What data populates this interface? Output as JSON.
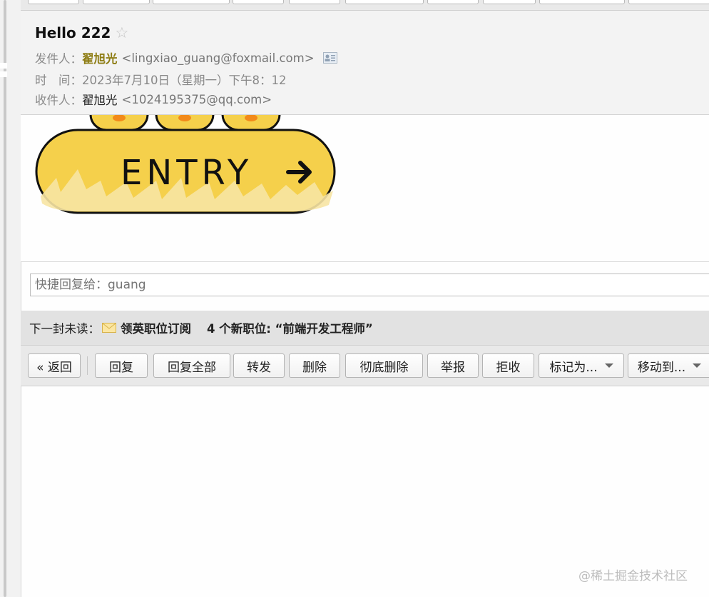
{
  "header": {
    "subject": "Hello 222",
    "sender_label": "发件人：",
    "sender_name": "翟旭光",
    "sender_email": "<lingxiao_guang@foxmail.com>",
    "time_label": "时　间：",
    "time_value": "2023年7月10日（星期一）下午8：12",
    "recipient_label": "收件人：",
    "recipient_name": "翟旭光",
    "recipient_email": "<1024195375@qq.com>"
  },
  "body": {
    "entry_text": "ENTRY"
  },
  "quick_reply": {
    "placeholder": "快捷回复给：guang"
  },
  "next_unread": {
    "label": "下一封未读：",
    "sender": "领英职位订阅",
    "subject": "4 个新职位: “前端开发工程师”"
  },
  "toolbar": {
    "back": "« 返回",
    "reply": "回复",
    "reply_all": "回复全部",
    "forward": "转发",
    "delete": "删除",
    "delete_permanently": "彻底删除",
    "report": "举报",
    "reject": "拒收",
    "mark_as": "标记为...",
    "move_to": "移动到..."
  },
  "watermark": "@稀土掘金技术社区",
  "colors": {
    "sender_name": "#8e7d14",
    "entry_fill": "#f5d04b",
    "entry_outline": "#111111"
  }
}
